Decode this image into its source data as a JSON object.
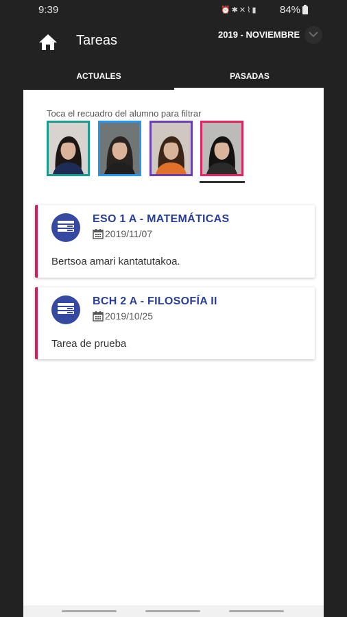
{
  "status_bar": {
    "time": "9:39",
    "icons": [
      "alarm-icon",
      "bluetooth-icon",
      "mute-icon",
      "wifi-icon",
      "signal-icon"
    ],
    "battery": "84%"
  },
  "app_bar": {
    "title": "Tareas",
    "period": "2019 - NOVIEMBRE"
  },
  "tabs": [
    {
      "label": "ACTUALES",
      "active": false
    },
    {
      "label": "PASADAS",
      "active": true
    }
  ],
  "filter": {
    "hint": "Toca el recuadro del alumno para filtrar",
    "students": [
      {
        "border": "#1b9a8f",
        "bg": "#d8d3ce",
        "hair": "#1c1714",
        "shirt": "#1c2c55",
        "selected": false
      },
      {
        "border": "#2196f3",
        "bg": "#6f7675",
        "hair": "#2a2420",
        "shirt": "#1f1f1f",
        "selected": false
      },
      {
        "border": "#6a3fb5",
        "bg": "#cfc8c0",
        "hair": "#3a2516",
        "shirt": "#e0702a",
        "selected": false
      },
      {
        "border": "#e0245e",
        "bg": "#bdbbb9",
        "hair": "#151312",
        "shirt": "#2a2a2a",
        "selected": true
      }
    ]
  },
  "tasks": [
    {
      "title": "ESO 1 A - MATEMÁTICAS",
      "date": "2019/11/07",
      "description": "Bertsoa amari kantatutakoa."
    },
    {
      "title": "BCH 2 A - FILOSOFÍA II",
      "date": "2019/10/25",
      "description": "Tarea de prueba"
    }
  ],
  "colors": {
    "accent": "#d81b60",
    "title_blue": "#273f9a",
    "icon_blue": "#3549a0",
    "background": "#222222"
  }
}
